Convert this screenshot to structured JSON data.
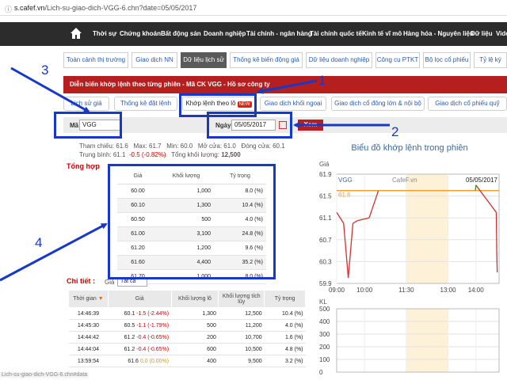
{
  "browser": {
    "url_host": "s.cafef.vn",
    "url_path": "/Lich-su-giao-dich-VGG-6.chn?date=05/05/2017"
  },
  "topnav": [
    "Thời sự",
    "Chứng khoán",
    "Bất động sản",
    "Doanh nghiệp",
    "Tài chính - ngân hàng",
    "Tài chính quốc tế",
    "Kinh tế vĩ mô",
    "Hàng hóa - Nguyên liệu",
    "Dữ liệu",
    "Vide"
  ],
  "subnav": [
    "Toàn cảnh thị trường",
    "Giao dịch NN",
    "Dữ liệu lịch sử",
    "Thống kê biến động giá",
    "Dữ liệu doanh nghiệp",
    "Công cụ PTKT",
    "Bộ lọc cổ phiếu",
    "Tỷ lệ ký"
  ],
  "banner": "Diễn biến khớp lệnh theo từng phiên - Mã CK VGG - Hồ sơ công ty",
  "tabs": [
    "Lịch sử giá",
    "Thống kê đặt lệnh",
    "Khớp lệnh theo lô",
    "Giao dịch khối ngoại",
    "Giao dịch cổ đông lớn & nội bộ",
    "Giao dịch cổ phiếu quỹ"
  ],
  "tab_new_badge": "NEW",
  "search": {
    "ma_label": "Mã",
    "ma_value": "VGG",
    "ngay_label": "Ngày",
    "ngay_value": "05/05/2017",
    "button": "Xem"
  },
  "summary": {
    "line1": [
      "Tham chiếu: 61.6",
      "Max: 61.7",
      "Min: 60.0",
      "Mở cửa: 61.0",
      "Đóng cửa: 60.1"
    ],
    "line2_a": "Trung bình: 61.1",
    "line2_b": "-0.5 (-0.82%)",
    "line2_c": "Tổng khối lượng:",
    "line2_d": "12,500"
  },
  "tonghop": {
    "title": "Tổng hợp",
    "headers": [
      "Giá",
      "Khối lượng",
      "Tỷ trọng"
    ],
    "rows": [
      [
        "60.00",
        "1,000",
        "8.0 (%)"
      ],
      [
        "60.10",
        "1,300",
        "10.4 (%)"
      ],
      [
        "60.50",
        "500",
        "4.0 (%)"
      ],
      [
        "61.00",
        "3,100",
        "24.8 (%)"
      ],
      [
        "61.20",
        "1,200",
        "9.6 (%)"
      ],
      [
        "61.60",
        "4,400",
        "35.2 (%)"
      ],
      [
        "61.70",
        "1,000",
        "8.0 (%)"
      ]
    ]
  },
  "chitiet": {
    "title": "Chi tiết :",
    "filter_label": "Giá",
    "filter_value": "Tất cả",
    "headers": [
      "Thời gian",
      "Giá",
      "Khối lượng lô",
      "Khối lượng tích lũy",
      "Tỷ trọng"
    ],
    "sort_icon": "caret-down-icon",
    "rows": [
      [
        "14:46:39",
        "60.1",
        "-1.5 (-2.44%)",
        "1,300",
        "12,500",
        "10.4 (%)"
      ],
      [
        "14:45:30",
        "60.5",
        "-1.1 (-1.79%)",
        "500",
        "11,200",
        "4.0 (%)"
      ],
      [
        "14:44:42",
        "61.2",
        "-0.4 (-0.65%)",
        "200",
        "10,700",
        "1.6 (%)"
      ],
      [
        "14:44:04",
        "61.2",
        "-0.4 (-0.65%)",
        "600",
        "10,500",
        "4.8 (%)"
      ],
      [
        "13:59:54",
        "61.6",
        "0.0 (0.00%)",
        "400",
        "9,500",
        "3.2 (%)"
      ]
    ]
  },
  "chart": {
    "title": "Biểu đồ khớp lệnh trong phiên",
    "price_axis_label": "Giá",
    "vol_axis_label": "KL",
    "symbol": "VGG",
    "watermark": "CafeF.vn",
    "date": "05/05/2017",
    "ref_label": "61.6",
    "price_ticks": [
      "61.9",
      "61.5",
      "61.1",
      "60.7",
      "60.3",
      "59.9"
    ],
    "time_ticks": [
      "09:00",
      "10:00",
      "11:30",
      "13:00",
      "14:00"
    ],
    "vol_ticks": [
      "500",
      "400",
      "300",
      "200",
      "100",
      "0"
    ],
    "colors": {
      "ref": "#f0a030",
      "down": "#d03030",
      "up": "#30a030",
      "lunch": "#fdf1d8"
    }
  },
  "chart_data": {
    "type": "line",
    "title": "Biểu đồ khớp lệnh trong phiên",
    "ylabel": "Giá",
    "ylim": [
      59.9,
      61.9
    ],
    "reference": 61.6,
    "series": [
      {
        "name": "VGG",
        "x": [
          "09:00",
          "09:15",
          "09:25",
          "09:35",
          "09:45",
          "10:10",
          "10:30",
          "11:30",
          "13:00",
          "13:59",
          "14:00",
          "14:44",
          "14:45",
          "14:46"
        ],
        "values": [
          61.2,
          61.0,
          60.0,
          61.0,
          61.05,
          61.1,
          61.6,
          61.6,
          61.6,
          61.6,
          61.7,
          61.2,
          60.5,
          60.1
        ]
      }
    ],
    "volume": {
      "ylabel": "KL",
      "ylim": [
        0,
        500
      ]
    }
  },
  "annotations": [
    "1",
    "2",
    "3",
    "4"
  ],
  "status_text": "Lich-su-giao-dich-VGG-6.chn#data"
}
